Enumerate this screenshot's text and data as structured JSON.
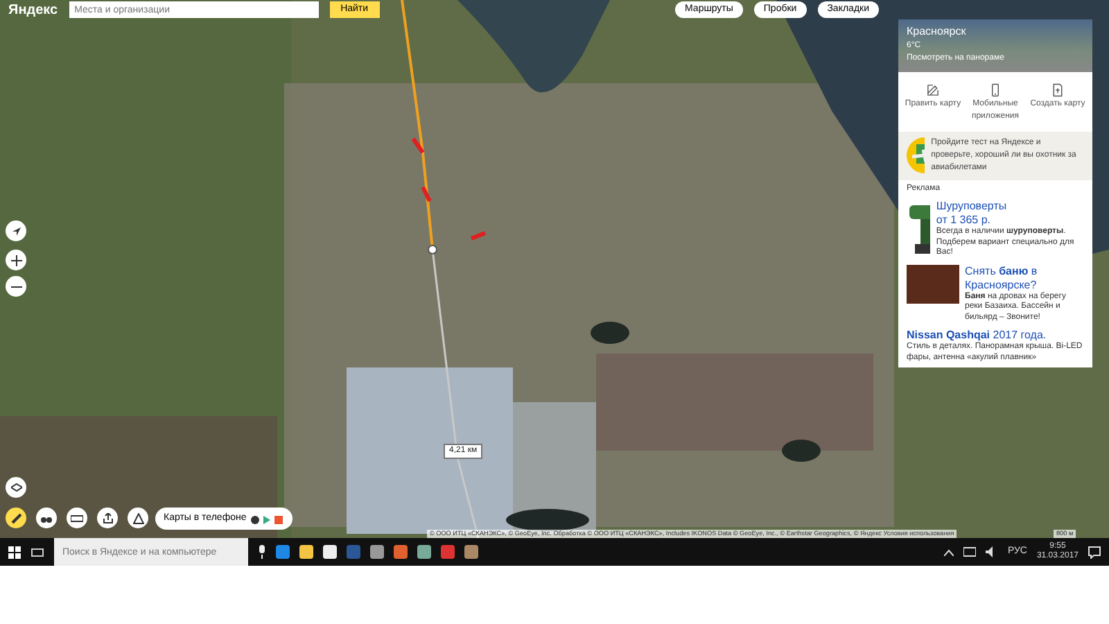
{
  "header": {
    "logo": "Яндекс",
    "search_placeholder": "Места и организации",
    "search_button": "Найти",
    "buttons": [
      "Маршруты",
      "Пробки",
      "Закладки"
    ]
  },
  "panorama": {
    "city": "Красноярск",
    "weather": "6°С",
    "link": "Посмотреть на панораме"
  },
  "actions": [
    {
      "label": "Править карту",
      "kind": "edit"
    },
    {
      "label": "Мобильные приложения",
      "kind": "phone"
    },
    {
      "label": "Создать карту",
      "kind": "create"
    }
  ],
  "promo": {
    "text": "Пройдите тест на Яндексе и проверьте, хороший ли вы охотник за авиабилетами"
  },
  "ads": {
    "label": "Реклама",
    "items": [
      {
        "kind": "drill",
        "title": "Шуруповерты",
        "subtitle": "от 1 365 р.",
        "text": "Всегда в наличии **шуруповерты**. Подберем вариант специально для Вас!"
      },
      {
        "kind": "photo",
        "title": "Снять **баню** в Красноярске?",
        "text": "**Баня** на дровах на берегу реки Базаиха. Бассейн и бильярд – Звоните!"
      },
      {
        "kind": "plain",
        "title": "**Nissan Qashqai** 2017 года.",
        "text": "Стиль в деталях. Панорамная крыша. Bi-LED фары, антенна «акулий плавник»"
      }
    ]
  },
  "map": {
    "distance_label": "4,21 км",
    "attribution": "© ООО ИТЦ «СКАНЭКС», © GeoEye, Inc. Обработка © ООО ИТЦ «СКАНЭКС», Includes IKONOS Data © GeoEye, Inc., © Earthstar Geographics, © Яндекс",
    "terms_link": "Условия использования",
    "scale": "800 м",
    "phone_pill": "Карты в телефоне"
  },
  "taskbar": {
    "search_placeholder": "Поиск в Яндексе и на компьютере",
    "language": "РУС",
    "time": "9:55",
    "date": "31.03.2017"
  }
}
